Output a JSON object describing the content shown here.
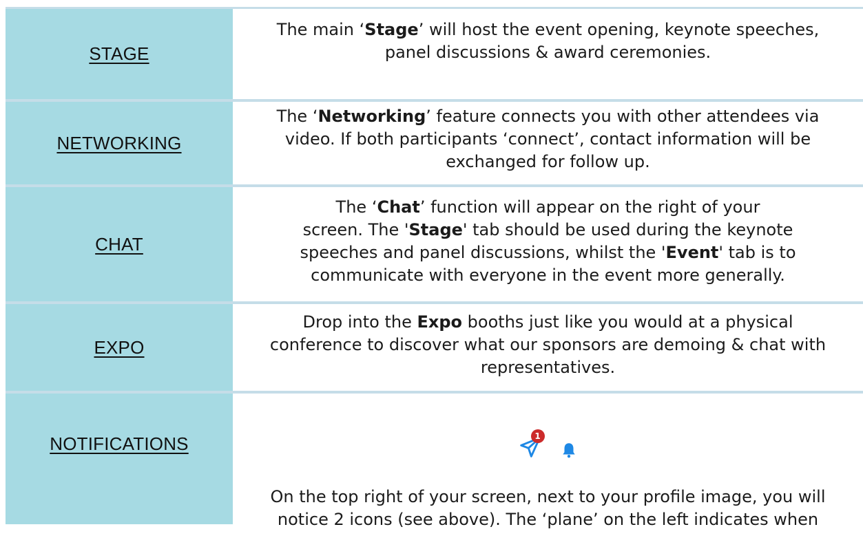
{
  "rows": [
    {
      "label": "STAGE",
      "text": [
        "The main ‘",
        "Stage",
        "’ will host the event opening, keynote speeches,",
        "panel discussions & award ceremonies."
      ]
    },
    {
      "label": "NETWORKING",
      "text": [
        "The ‘",
        "Networking",
        "’ feature connects you with other attendees via",
        "video. If both participants ‘connect’, contact information will be",
        "exchanged for follow up."
      ]
    },
    {
      "label": "CHAT",
      "text": [
        "The ‘",
        "Chat",
        "’ function will appear on the right of your",
        "screen. The '",
        "Stage",
        "' tab should be used during the keynote",
        "speeches and panel discussions, whilst the '",
        "Event",
        "' tab is to",
        "communicate with everyone in the event more generally."
      ]
    },
    {
      "label": "EXPO",
      "text": [
        "Drop into the ",
        "Expo",
        " booths just like you would at a physical",
        "conference to discover what our sponsors are demoing & chat with",
        "representatives."
      ]
    },
    {
      "label": "NOTIFICATIONS",
      "badge": "1",
      "icons": [
        "paper-plane-icon",
        "bell-icon"
      ],
      "text": [
        "On the top right of your screen, next to your profile image, you will",
        "notice 2 icons (see above). The ‘plane’ on the left indicates when"
      ]
    }
  ],
  "colors": {
    "label_bg": "#a6dae3",
    "divider": "#c5dde8",
    "icon_blue": "#1e88e5",
    "badge": "#cc2b2b"
  }
}
